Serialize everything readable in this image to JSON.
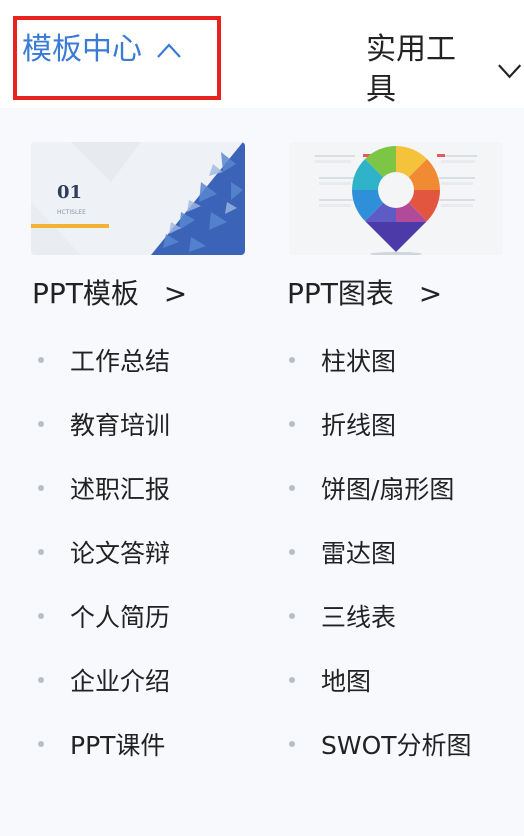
{
  "nav": {
    "tabs": [
      {
        "label": "模板中心",
        "state": "expanded",
        "icon": "chevron-up-icon"
      },
      {
        "label": "实用工具",
        "state": "collapsed",
        "icon": "chevron-down-icon"
      }
    ]
  },
  "colors": {
    "accent": "#3a7bd5",
    "highlight_border": "#e8231f",
    "text": "#222222",
    "bullet": "#b9bfc9",
    "panel_bg": "#f7f9fc"
  },
  "sections": [
    {
      "title": "PPT模板",
      "title_arrow": ">",
      "thumbnail": {
        "heading": "01",
        "caption": "HCTISLEE"
      },
      "items": [
        "工作总结",
        "教育培训",
        "述职汇报",
        "论文答辩",
        "个人简历",
        "企业介绍",
        "PPT课件"
      ]
    },
    {
      "title": "PPT图表",
      "title_arrow": ">",
      "thumbnail": {
        "heading": "",
        "caption": ""
      },
      "items": [
        "柱状图",
        "折线图",
        "饼图/扇形图",
        "雷达图",
        "三线表",
        "地图",
        "SWOT分析图"
      ]
    }
  ]
}
